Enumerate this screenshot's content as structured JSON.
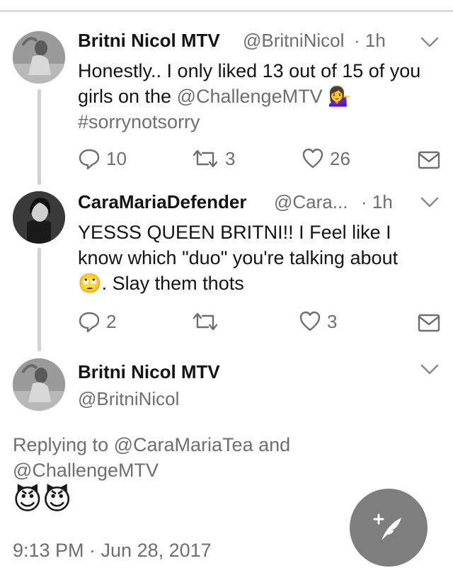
{
  "tweets": [
    {
      "name": "Britni Nicol MTV",
      "handle": "@BritniNicol",
      "time": "· 1h",
      "text_parts": [
        "Honestly.. I only liked 13 out of 15 of you girls on the ",
        "@ChallengeMTV",
        "#sorrynotsorry"
      ],
      "emoji": "💁‍♀️",
      "replies": "10",
      "retweets": "3",
      "likes": "26"
    },
    {
      "name": "CaraMariaDefender",
      "handle": "@Cara...",
      "time": "· 1h",
      "text_parts": [
        "YESSS QUEEN BRITNI!! I Feel like I know which \"duo\" you're talking about",
        ". Slay them thots"
      ],
      "emoji": "🙄",
      "replies": "2",
      "retweets": "",
      "likes": "3"
    }
  ],
  "main_tweet": {
    "name": "Britni Nicol MTV",
    "handle": "@BritniNicol",
    "replying_prefix": "Replying to",
    "replying_user1": "@CaraMariaTea",
    "replying_and": "and",
    "replying_user2": "@ChallengeMTV",
    "emoji": "😈😈",
    "timestamp": "9:13 PM · Jun 28, 2017"
  },
  "icons": {
    "reply": "reply-icon",
    "retweet": "retweet-icon",
    "like": "heart-icon",
    "dm": "mail-icon",
    "more": "chevron-down-icon",
    "compose": "compose-tweet-icon"
  }
}
